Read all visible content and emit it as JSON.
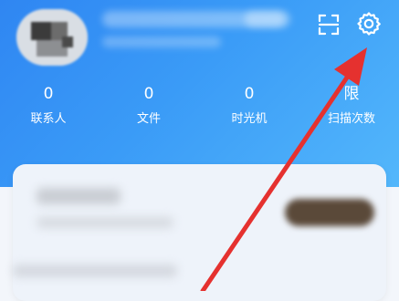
{
  "header": {
    "scan_icon": "scan-icon",
    "settings_icon": "gear-icon"
  },
  "stats": [
    {
      "value": "0",
      "label": "联系人"
    },
    {
      "value": "0",
      "label": "文件"
    },
    {
      "value": "0",
      "label": "时光机"
    },
    {
      "value": "限",
      "label": "扫描次数"
    }
  ],
  "colors": {
    "hero_start": "#2f86f2",
    "hero_end": "#53b7fb",
    "annotation_arrow": "#e5312f",
    "card_button": "#5a4939"
  }
}
